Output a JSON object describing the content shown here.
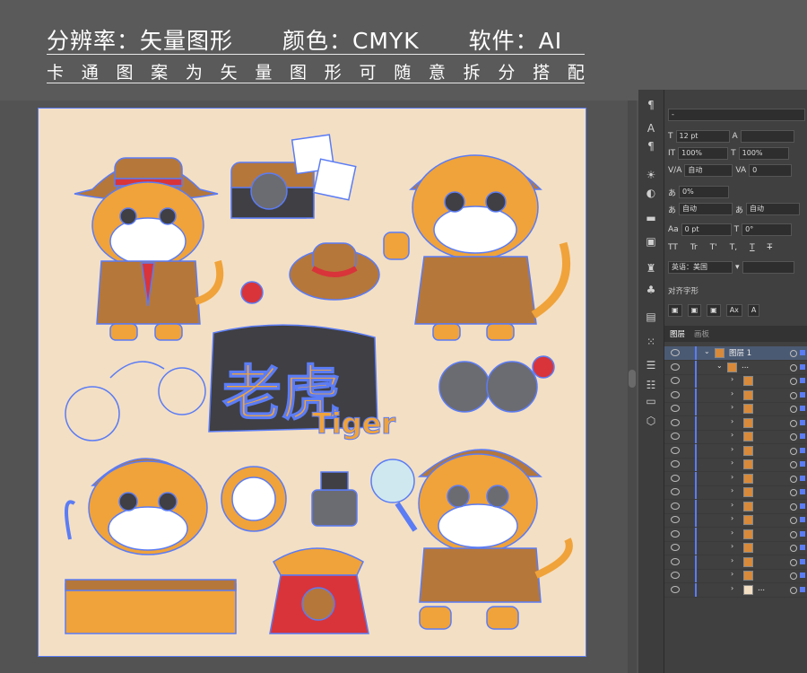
{
  "banner": {
    "resolution": "分辨率：矢量图形",
    "color_mode": "颜色：CMYK",
    "software": "软件：AI",
    "description_chars": [
      "卡",
      "通",
      "图",
      "案",
      "为",
      "矢",
      "量",
      "图",
      "形",
      "可",
      "随",
      "意",
      "拆",
      "分",
      "搭",
      "配"
    ]
  },
  "artboard": {
    "title_text": "老虎",
    "subtitle_text": "Tiger",
    "colors": {
      "background": "#f3dfc4",
      "selection": "#5b7cf5",
      "orange": "#f0a33a",
      "brown": "#b5773a",
      "dark": "#3f3f44",
      "red": "#d8343a",
      "white": "#ffffff"
    }
  },
  "char_panel": {
    "font_size": "12 pt",
    "leading": "",
    "vert_scale": "100%",
    "horiz_scale": "100%",
    "tracking_mode": "自动",
    "tracking_value": "0",
    "tsume": "0%",
    "auto1": "自动",
    "auto2": "自动",
    "baseline": "0 pt",
    "rotation": "0°",
    "tt_buttons": [
      "TT",
      "Tr",
      "T'",
      "T,",
      "T",
      "T"
    ],
    "language": "英语：美国",
    "aa_label": "ᵃa",
    "align_glyph_title": "对齐字形",
    "ax_label": "Ax"
  },
  "layers_panel": {
    "tab_layers": "图层",
    "tab_artboards": "画板",
    "top_layer_name": "图层 1",
    "group_name": "...",
    "bottom_name": "..."
  }
}
